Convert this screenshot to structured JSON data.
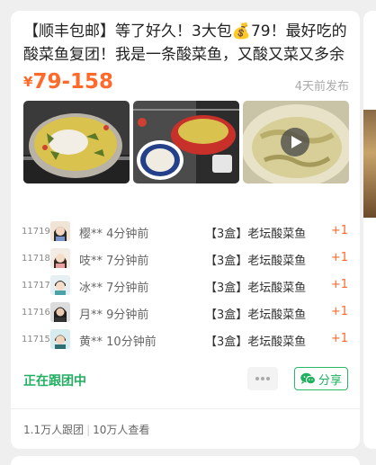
{
  "post": {
    "title": "【顺丰包邮】等了好久！3大包💰79！最好吃的酸菜鱼复团！我是一条酸菜鱼，又酸又菜又多余",
    "price_symbol": "¥",
    "price_range": "79-158",
    "posted_time": "4天前发布"
  },
  "orders": [
    {
      "id": "11719",
      "name": "樱**",
      "time": "4分钟前",
      "product": "【3盒】老坛酸菜鱼",
      "qty": "+1"
    },
    {
      "id": "11718",
      "name": "吱**",
      "time": "7分钟前",
      "product": "【3盒】老坛酸菜鱼",
      "qty": "+1"
    },
    {
      "id": "11717",
      "name": "冰**",
      "time": "7分钟前",
      "product": "【3盒】老坛酸菜鱼",
      "qty": "+1"
    },
    {
      "id": "11716",
      "name": "月**",
      "time": "9分钟前",
      "product": "【3盒】老坛酸菜鱼",
      "qty": "+1"
    },
    {
      "id": "11715",
      "name": "黄**",
      "time": "10分钟前",
      "product": "【3盒】老坛酸菜鱼",
      "qty": "+1"
    }
  ],
  "actions": {
    "following_label": "正在跟团中",
    "more_icon": "more-dots-icon",
    "share_label": "分享",
    "share_icon": "wechat-icon"
  },
  "stats": {
    "followers": "1.1万人跟团",
    "views": "10万人查看"
  },
  "colors": {
    "accent_orange": "#ff6a2b",
    "accent_green": "#20b060"
  }
}
